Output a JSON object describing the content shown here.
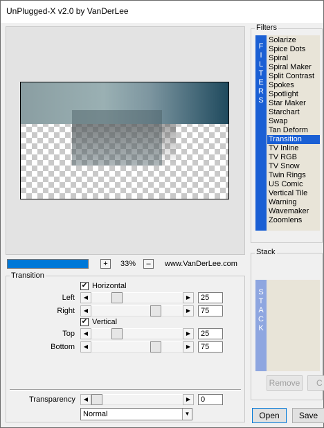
{
  "window": {
    "title": "UnPlugged-X v2.0 by VanDerLee"
  },
  "toolbar": {
    "zoom_in": "+",
    "zoom": "33%",
    "zoom_out": "–",
    "website": "www.VanDerLee.com"
  },
  "transition": {
    "group_label": "Transition",
    "horizontal": {
      "label": "Horizontal",
      "checked": true,
      "mark": "✔"
    },
    "left": {
      "label": "Left",
      "value": "25"
    },
    "right": {
      "label": "Right",
      "value": "75"
    },
    "vertical": {
      "label": "Vertical",
      "checked": true,
      "mark": "✔"
    },
    "top": {
      "label": "Top",
      "value": "25"
    },
    "bottom": {
      "label": "Bottom",
      "value": "75"
    },
    "transparency": {
      "label": "Transparency",
      "value": "0"
    },
    "blend_mode": "Normal"
  },
  "filters": {
    "label": "Filters",
    "strip_letters": [
      "F",
      "I",
      "L",
      "T",
      "E",
      "R",
      "S"
    ],
    "items": [
      "Solarize",
      "Spice Dots",
      "Spiral",
      "Spiral Maker",
      "Split Contrast",
      "Spokes",
      "Spotlight",
      "Star Maker",
      "Starchart",
      "Swap",
      "Tan Deform",
      "Transition",
      "TV Inline",
      "TV RGB",
      "TV Snow",
      "Twin Rings",
      "US Comic",
      "Vertical Tile",
      "Warning",
      "Wavemaker",
      "Zoomlens"
    ],
    "selected": "Transition"
  },
  "stack": {
    "label": "Stack",
    "strip_letters": [
      "S",
      "T",
      "A",
      "C",
      "K"
    ],
    "remove": "Remove",
    "partial_button": "C"
  },
  "buttons": {
    "open": "Open",
    "save": "Save"
  },
  "icons": {
    "left_arrow": "◀",
    "right_arrow": "▶",
    "down_arrow": "▼"
  },
  "colors": {
    "accent": "#1a5fd4",
    "progress": "#0078d7",
    "stack_strip": "#8ea6e0"
  }
}
